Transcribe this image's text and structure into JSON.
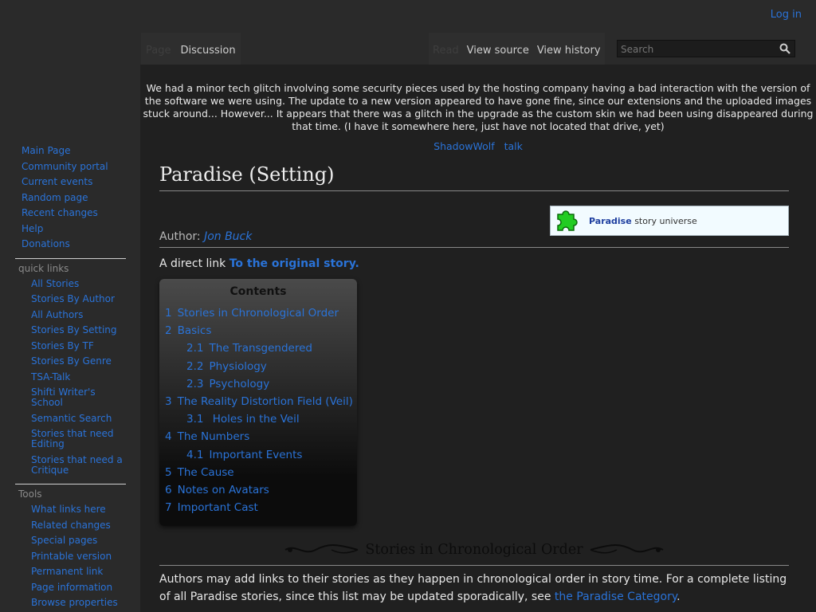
{
  "personal": {
    "login": "Log in"
  },
  "tabs_left": [
    {
      "label": "Page",
      "state": "inactive"
    },
    {
      "label": "Discussion",
      "state": "active"
    }
  ],
  "tabs_right": [
    {
      "label": "Read",
      "state": "inactive"
    },
    {
      "label": "View source",
      "state": "active"
    },
    {
      "label": "View history",
      "state": "active"
    }
  ],
  "search": {
    "placeholder": "Search",
    "icon": "search-icon"
  },
  "sidebar": {
    "navigation": [
      "Main Page",
      "Community portal",
      "Current events",
      "Random page",
      "Recent changes",
      "Help",
      "Donations"
    ],
    "quick_links_heading": "quick links",
    "quick_links": [
      "All Stories",
      "Stories By Author",
      "All Authors",
      "Stories By Setting",
      "Stories By TF",
      "Stories By Genre",
      "TSA-Talk",
      "Shifti Writer's School",
      "Semantic Search",
      "Stories that need Editing",
      "Stories that need a Critique"
    ],
    "tools_heading": "Tools",
    "tools": [
      "What links here",
      "Related changes",
      "Special pages",
      "Printable version",
      "Permanent link",
      "Page information",
      "Browse properties"
    ]
  },
  "sitenotice": {
    "text": "We had a minor tech glitch involving some security pieces used by the hosting company having a bad interaction with the version of the software we were using. The update to a new version appeared to have gone fine, since our extensions and the uploaded images stuck around... However... It appears that there was a glitch in the upgrade as the custom skin we had been using disappeared during that time. (I have it somewhere here, just have not located that drive, yet)",
    "sig_user": "ShadowWolf",
    "sig_talk": "talk"
  },
  "page": {
    "title": "Paradise (Setting)",
    "author_label": "Author:",
    "author_name": "Jon Buck",
    "direct_prefix": "A direct link",
    "direct_link": "To the original story.",
    "universe_box": {
      "name": "Paradise",
      "suffix": "story universe",
      "icon": "puzzle-piece-icon",
      "icon_color": "#22cc22"
    }
  },
  "toc": {
    "title": "Contents",
    "items": [
      {
        "num": "1",
        "label": "Stories in Chronological Order",
        "level": 1
      },
      {
        "num": "2",
        "label": "Basics",
        "level": 1
      },
      {
        "num": "2.1",
        "label": "The Transgendered",
        "level": 2
      },
      {
        "num": "2.2",
        "label": "Physiology",
        "level": 2
      },
      {
        "num": "2.3",
        "label": "Psychology",
        "level": 2
      },
      {
        "num": "3",
        "label": "The Reality Distortion Field (Veil)",
        "level": 1
      },
      {
        "num": "3.1",
        "label": " Holes in the Veil",
        "level": 2
      },
      {
        "num": "4",
        "label": "The Numbers",
        "level": 1
      },
      {
        "num": "4.1",
        "label": "Important Events",
        "level": 2
      },
      {
        "num": "5",
        "label": "The Cause",
        "level": 1
      },
      {
        "num": "6",
        "label": "Notes on Avatars",
        "level": 1
      },
      {
        "num": "7",
        "label": "Important Cast",
        "level": 1
      }
    ]
  },
  "section": {
    "heading": "Stories in Chronological Order",
    "para_prefix": "Authors may add links to their stories as they happen in chronological order in story time. For a complete listing of all Paradise stories, since this list may be updated sporadically, see ",
    "para_link": "the Paradise Category",
    "para_suffix": "."
  }
}
